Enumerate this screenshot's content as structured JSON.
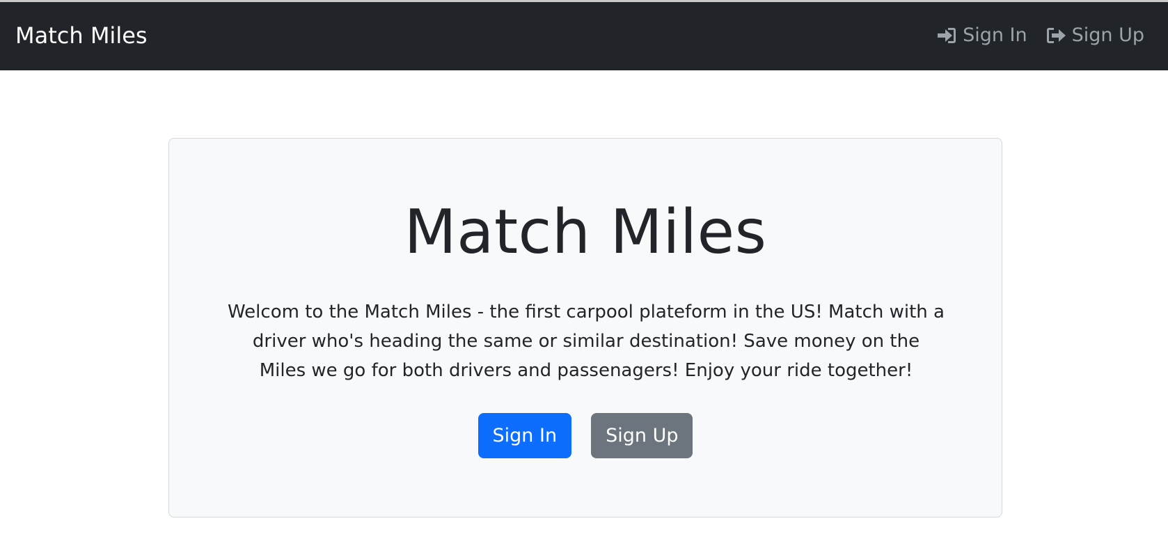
{
  "navbar": {
    "brand": "Match Miles",
    "links": [
      {
        "label": "Sign In",
        "icon": "sign-in-icon"
      },
      {
        "label": "Sign Up",
        "icon": "sign-up-icon"
      }
    ]
  },
  "hero": {
    "title": "Match Miles",
    "lead": "Welcom to the Match Miles - the first carpool plateform in the US! Match with a driver who's heading the same or similar destination! Save money on the Miles we go for both drivers and passenagers! Enjoy your ride together!",
    "buttons": {
      "sign_in": "Sign In",
      "sign_up": "Sign Up"
    }
  },
  "colors": {
    "navbar_bg": "#212529",
    "nav_link": "#9ca3a9",
    "primary": "#0d6efd",
    "secondary": "#6c757d",
    "jumbotron_bg": "#f8f9fa"
  }
}
